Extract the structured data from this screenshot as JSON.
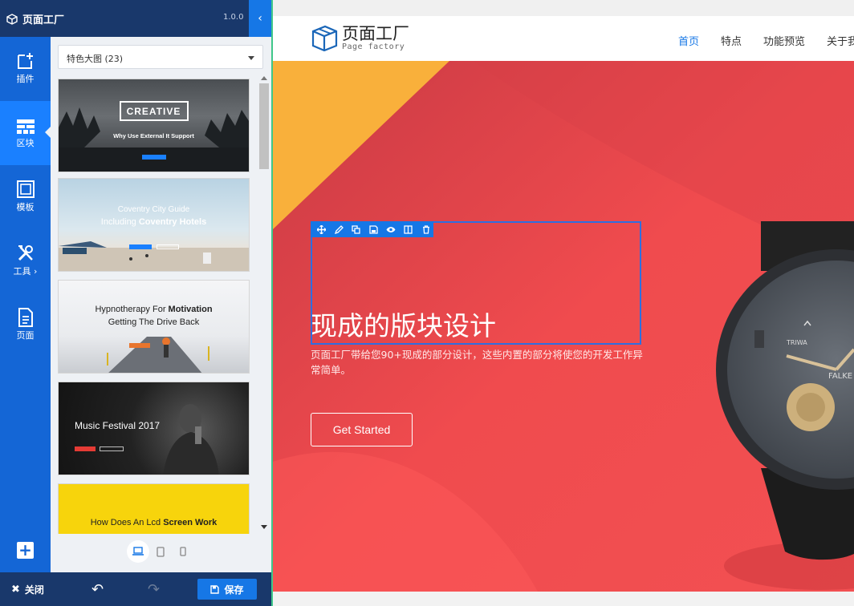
{
  "app": {
    "brand": "页面工厂",
    "version": "1.0.0"
  },
  "rail": {
    "items": [
      {
        "label": "插件",
        "icon": "plugin-icon"
      },
      {
        "label": "区块",
        "icon": "blocks-icon",
        "active": true
      },
      {
        "label": "模板",
        "icon": "template-icon"
      },
      {
        "label": "工具 ›",
        "icon": "tools-icon"
      },
      {
        "label": "页面",
        "icon": "page-icon"
      }
    ],
    "add_icon": "plus-square-icon"
  },
  "blocks_panel": {
    "category_select": "特色大图 (23)",
    "thumbnails": [
      {
        "title": "CREATIVE",
        "subtitle": "Why Use External It Support"
      },
      {
        "title": "Coventry City Guide",
        "subtitle_prefix": "Including ",
        "subtitle_bold": "Coventry Hotels"
      },
      {
        "title_prefix": "Hypnotherapy For ",
        "title_bold": "Motivation",
        "subtitle": "Getting The Drive Back"
      },
      {
        "title": "Music Festival 2017"
      },
      {
        "title_prefix": "How Does An Lcd ",
        "title_bold": "Screen Work"
      }
    ],
    "devices": [
      "desktop-icon",
      "tablet-icon",
      "mobile-icon"
    ]
  },
  "bottom_bar": {
    "close_label": "关闭",
    "save_label": "保存"
  },
  "site": {
    "logo_name": "页面工厂",
    "logo_sub": "Page factory",
    "nav": [
      "首页",
      "特点",
      "功能预览",
      "关于我"
    ]
  },
  "hero": {
    "title": "现成的版块设计",
    "description": "页面工厂带给您90+现成的部分设计，这些内置的部分将使您的开发工作异常简单。",
    "button": "Get Started",
    "watch_brand": "TRIWA",
    "watch_model": "FALKE"
  },
  "colors": {
    "primary": "#1677e6",
    "dark": "#19386b",
    "hero_red": "#f04b4e",
    "hero_yellow": "#f9b03b"
  }
}
